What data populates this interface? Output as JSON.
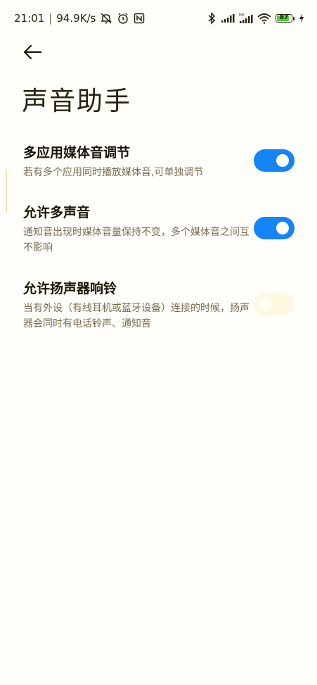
{
  "status_bar": {
    "time": "21:01",
    "separator": "|",
    "net_speed": "94.9K/s",
    "battery_level": "87",
    "battery_fill_fraction": 0.87,
    "battery_color": "#4cd137",
    "icons": [
      "mute-icon",
      "alarm-icon",
      "nfc-icon",
      "bluetooth-icon",
      "signal-icon",
      "hd-signal-icon",
      "wifi-icon",
      "battery-icon",
      "charging-icon"
    ]
  },
  "header": {
    "back_icon": "back-arrow-icon",
    "title": "声音助手"
  },
  "settings": [
    {
      "title": "多应用媒体音调节",
      "description": "若有多个应用同时播放媒体音,可单独调节",
      "enabled": true
    },
    {
      "title": "允许多声音",
      "description": "通知音出现时媒体音量保持不变，多个媒体音之间互不影响",
      "enabled": true
    },
    {
      "title": "允许扬声器响铃",
      "description": "当有外设（有线耳机或蓝牙设备）连接的时候，扬声器会同时有电话铃声、通知音",
      "enabled": false
    }
  ],
  "colors": {
    "accent": "#1584f6",
    "toggle_off": "#fdf9e1",
    "background": "#fffefa",
    "description_text": "#7a6a4e"
  }
}
